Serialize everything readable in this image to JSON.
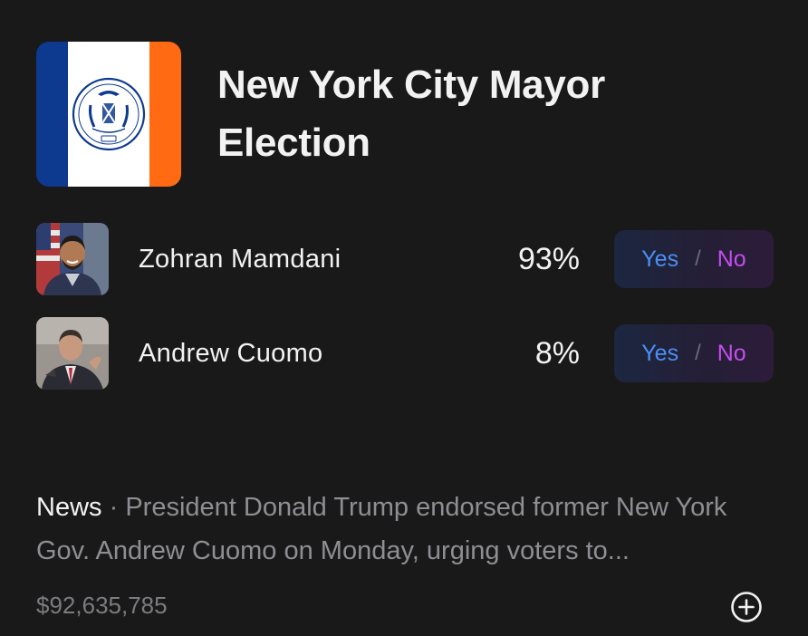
{
  "market": {
    "title": "New York City Mayor Election"
  },
  "candidates": [
    {
      "name": "Zohran Mamdani",
      "percent": "93%",
      "yes_label": "Yes",
      "separator": "/",
      "no_label": "No"
    },
    {
      "name": "Andrew Cuomo",
      "percent": "8%",
      "yes_label": "Yes",
      "separator": "/",
      "no_label": "No"
    }
  ],
  "news": {
    "label": "News",
    "separator": "·",
    "text": "President Donald Trump endorsed former New York Gov. Andrew Cuomo on Monday, urging voters to..."
  },
  "footer": {
    "volume": "$92,635,785",
    "add_icon": "plus-circle-icon"
  },
  "colors": {
    "background": "#19191a",
    "yes": "#4b8ff5",
    "no": "#c64cf0",
    "flag_blue": "#0d3a8f",
    "flag_orange": "#ff6a13"
  }
}
